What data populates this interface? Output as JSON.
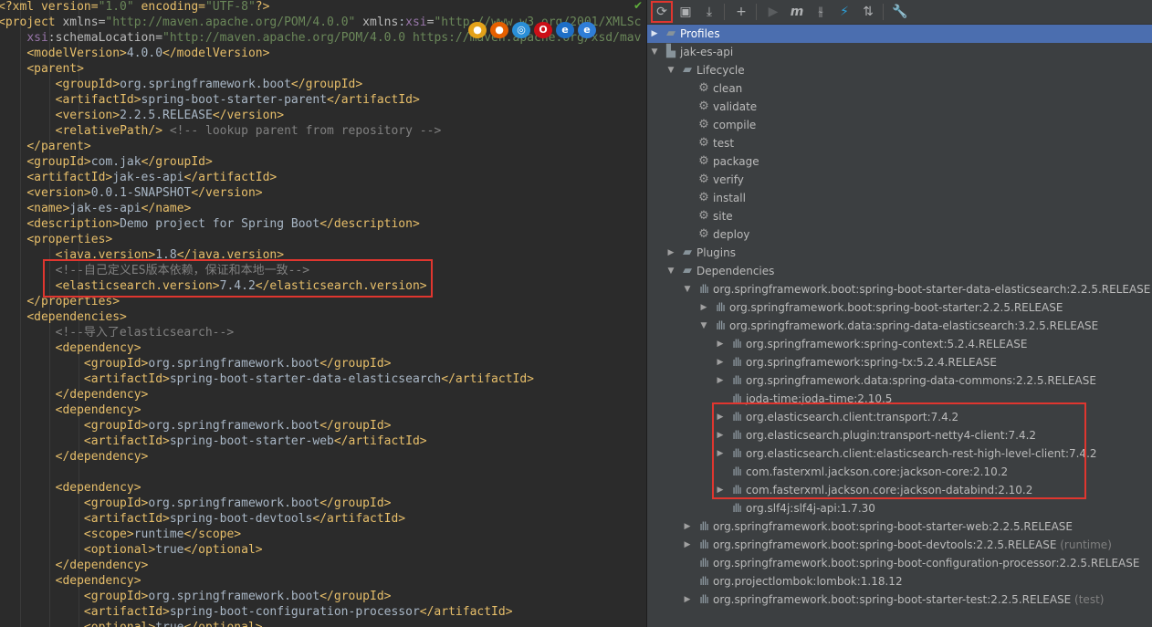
{
  "editor": {
    "lines": [
      [
        [
          "t",
          "<?xml version="
        ],
        [
          "v",
          "\"1.0\""
        ],
        [
          "t",
          " encoding="
        ],
        [
          "v",
          "\"UTF-8\""
        ],
        [
          "t",
          "?>"
        ]
      ],
      [
        [
          "t",
          "<project "
        ],
        [
          "a",
          "xmlns="
        ],
        [
          "v",
          "\"http://maven.apache.org/POM/4.0.0\""
        ],
        [
          "a",
          " xmlns"
        ],
        [
          "tx",
          ":"
        ],
        [
          "ns",
          "xsi"
        ],
        [
          "a",
          "="
        ],
        [
          "v",
          "\"http://www.w3.org/2001/XMLSc"
        ]
      ],
      [
        [
          "tx",
          "    "
        ],
        [
          "ns",
          "xsi"
        ],
        [
          "a",
          ":schemaLocation="
        ],
        [
          "v",
          "\"http://maven.apache.org/POM/4.0.0 https://maven.apache.org/xsd/mav"
        ]
      ],
      [
        [
          "tx",
          "    "
        ],
        [
          "t",
          "<modelVersion>"
        ],
        [
          "tx",
          "4.0.0"
        ],
        [
          "t",
          "</modelVersion>"
        ]
      ],
      [
        [
          "tx",
          "    "
        ],
        [
          "t",
          "<parent>"
        ]
      ],
      [
        [
          "tx",
          "        "
        ],
        [
          "t",
          "<groupId>"
        ],
        [
          "tx",
          "org.springframework.boot"
        ],
        [
          "t",
          "</groupId>"
        ]
      ],
      [
        [
          "tx",
          "        "
        ],
        [
          "t",
          "<artifactId>"
        ],
        [
          "tx",
          "spring-boot-starter-parent"
        ],
        [
          "t",
          "</artifactId>"
        ]
      ],
      [
        [
          "tx",
          "        "
        ],
        [
          "t",
          "<version>"
        ],
        [
          "tx",
          "2.2.5.RELEASE"
        ],
        [
          "t",
          "</version>"
        ]
      ],
      [
        [
          "tx",
          "        "
        ],
        [
          "t",
          "<relativePath/>"
        ],
        [
          "c",
          " <!-- lookup parent from repository -->"
        ]
      ],
      [
        [
          "tx",
          "    "
        ],
        [
          "t",
          "</parent>"
        ]
      ],
      [
        [
          "tx",
          "    "
        ],
        [
          "t",
          "<groupId>"
        ],
        [
          "tx",
          "com.jak"
        ],
        [
          "t",
          "</groupId>"
        ]
      ],
      [
        [
          "tx",
          "    "
        ],
        [
          "t",
          "<artifactId>"
        ],
        [
          "tx",
          "jak-es-api"
        ],
        [
          "t",
          "</artifactId>"
        ]
      ],
      [
        [
          "tx",
          "    "
        ],
        [
          "t",
          "<version>"
        ],
        [
          "tx",
          "0.0.1-SNAPSHOT"
        ],
        [
          "t",
          "</version>"
        ]
      ],
      [
        [
          "tx",
          "    "
        ],
        [
          "t",
          "<name>"
        ],
        [
          "tx",
          "jak-es-api"
        ],
        [
          "t",
          "</name>"
        ]
      ],
      [
        [
          "tx",
          "    "
        ],
        [
          "t",
          "<description>"
        ],
        [
          "tx",
          "Demo project for Spring Boot"
        ],
        [
          "t",
          "</description>"
        ]
      ],
      [
        [
          "tx",
          "    "
        ],
        [
          "t",
          "<properties>"
        ]
      ],
      [
        [
          "tx",
          "        "
        ],
        [
          "t",
          "<java.version>"
        ],
        [
          "tx",
          "1.8"
        ],
        [
          "t",
          "</java.version>"
        ]
      ],
      [
        [
          "tx",
          "        "
        ],
        [
          "c",
          "<!--自己定义ES版本依赖，保证和本地一致-->"
        ]
      ],
      [
        [
          "tx",
          "        "
        ],
        [
          "t",
          "<elasticsearch.version>"
        ],
        [
          "tx",
          "7.4.2"
        ],
        [
          "t",
          "</elasticsearch.version>"
        ]
      ],
      [
        [
          "tx",
          "    "
        ],
        [
          "t",
          "</properties>"
        ]
      ],
      [
        [
          "tx",
          "    "
        ],
        [
          "t",
          "<dependencies>"
        ]
      ],
      [
        [
          "tx",
          "        "
        ],
        [
          "c",
          "<!--导入了elasticsearch-->"
        ]
      ],
      [
        [
          "tx",
          "        "
        ],
        [
          "t",
          "<dependency>"
        ]
      ],
      [
        [
          "tx",
          "            "
        ],
        [
          "t",
          "<groupId>"
        ],
        [
          "tx",
          "org.springframework.boot"
        ],
        [
          "t",
          "</groupId>"
        ]
      ],
      [
        [
          "tx",
          "            "
        ],
        [
          "t",
          "<artifactId>"
        ],
        [
          "tx",
          "spring-boot-starter-data-elasticsearch"
        ],
        [
          "t",
          "</artifactId>"
        ]
      ],
      [
        [
          "tx",
          "        "
        ],
        [
          "t",
          "</dependency>"
        ]
      ],
      [
        [
          "tx",
          "        "
        ],
        [
          "t",
          "<dependency>"
        ]
      ],
      [
        [
          "tx",
          "            "
        ],
        [
          "t",
          "<groupId>"
        ],
        [
          "tx",
          "org.springframework.boot"
        ],
        [
          "t",
          "</groupId>"
        ]
      ],
      [
        [
          "tx",
          "            "
        ],
        [
          "t",
          "<artifactId>"
        ],
        [
          "tx",
          "spring-boot-starter-web"
        ],
        [
          "t",
          "</artifactId>"
        ]
      ],
      [
        [
          "tx",
          "        "
        ],
        [
          "t",
          "</dependency>"
        ]
      ],
      [],
      [
        [
          "tx",
          "        "
        ],
        [
          "t",
          "<dependency>"
        ]
      ],
      [
        [
          "tx",
          "            "
        ],
        [
          "t",
          "<groupId>"
        ],
        [
          "tx",
          "org.springframework.boot"
        ],
        [
          "t",
          "</groupId>"
        ]
      ],
      [
        [
          "tx",
          "            "
        ],
        [
          "t",
          "<artifactId>"
        ],
        [
          "tx",
          "spring-boot-devtools"
        ],
        [
          "t",
          "</artifactId>"
        ]
      ],
      [
        [
          "tx",
          "            "
        ],
        [
          "t",
          "<scope>"
        ],
        [
          "tx",
          "runtime"
        ],
        [
          "t",
          "</scope>"
        ]
      ],
      [
        [
          "tx",
          "            "
        ],
        [
          "t",
          "<optional>"
        ],
        [
          "tx",
          "true"
        ],
        [
          "t",
          "</optional>"
        ]
      ],
      [
        [
          "tx",
          "        "
        ],
        [
          "t",
          "</dependency>"
        ]
      ],
      [
        [
          "tx",
          "        "
        ],
        [
          "t",
          "<dependency>"
        ]
      ],
      [
        [
          "tx",
          "            "
        ],
        [
          "t",
          "<groupId>"
        ],
        [
          "tx",
          "org.springframework.boot"
        ],
        [
          "t",
          "</groupId>"
        ]
      ],
      [
        [
          "tx",
          "            "
        ],
        [
          "t",
          "<artifactId>"
        ],
        [
          "tx",
          "spring-boot-configuration-processor"
        ],
        [
          "t",
          "</artifactId>"
        ]
      ],
      [
        [
          "tx",
          "            "
        ],
        [
          "t",
          "<optional>"
        ],
        [
          "tx",
          "true"
        ],
        [
          "t",
          "</optional>"
        ]
      ]
    ],
    "browser_icons": [
      {
        "name": "chrome-icon",
        "color": "#e3a21a"
      },
      {
        "name": "firefox-icon",
        "color": "#e66000"
      },
      {
        "name": "safari-icon",
        "color": "#2a8fd6"
      },
      {
        "name": "opera-icon",
        "color": "#cc0f16"
      },
      {
        "name": "ie-icon",
        "color": "#1e6fc7"
      },
      {
        "name": "edge-icon",
        "color": "#2f7ed8"
      }
    ]
  },
  "toolbar": {
    "buttons": [
      {
        "name": "reimport-button",
        "icon": "⟳"
      },
      {
        "name": "generate-sources-button",
        "icon": "▣"
      },
      {
        "name": "download-sources-button",
        "icon": "⤓"
      },
      {
        "name": "add-maven-project-button",
        "icon": "+"
      },
      {
        "name": "run-maven-build-button",
        "icon": "▶"
      },
      {
        "name": "execute-goal-button",
        "icon": "m"
      },
      {
        "name": "toggle-offline-button",
        "icon": "⫳"
      },
      {
        "name": "skip-tests-button",
        "icon": "⚡"
      },
      {
        "name": "show-dependencies-button",
        "icon": "⇅"
      },
      {
        "name": "maven-settings-button",
        "icon": "🔧"
      }
    ]
  },
  "tree": [
    {
      "depth": 0,
      "arrow": "right",
      "icon": "folder",
      "label": "Profiles",
      "selected": true
    },
    {
      "depth": 0,
      "arrow": "down",
      "icon": "project",
      "label": "jak-es-api"
    },
    {
      "depth": 1,
      "arrow": "down",
      "icon": "folder",
      "label": "Lifecycle"
    },
    {
      "depth": 2,
      "arrow": "",
      "icon": "gear",
      "label": "clean"
    },
    {
      "depth": 2,
      "arrow": "",
      "icon": "gear",
      "label": "validate"
    },
    {
      "depth": 2,
      "arrow": "",
      "icon": "gear",
      "label": "compile"
    },
    {
      "depth": 2,
      "arrow": "",
      "icon": "gear",
      "label": "test"
    },
    {
      "depth": 2,
      "arrow": "",
      "icon": "gear",
      "label": "package"
    },
    {
      "depth": 2,
      "arrow": "",
      "icon": "gear",
      "label": "verify"
    },
    {
      "depth": 2,
      "arrow": "",
      "icon": "gear",
      "label": "install"
    },
    {
      "depth": 2,
      "arrow": "",
      "icon": "gear",
      "label": "site"
    },
    {
      "depth": 2,
      "arrow": "",
      "icon": "gear",
      "label": "deploy"
    },
    {
      "depth": 1,
      "arrow": "right",
      "icon": "folder",
      "label": "Plugins"
    },
    {
      "depth": 1,
      "arrow": "down",
      "icon": "folder",
      "label": "Dependencies"
    },
    {
      "depth": 2,
      "arrow": "down",
      "icon": "dep",
      "label": "org.springframework.boot:spring-boot-starter-data-elasticsearch:2.2.5.RELEASE"
    },
    {
      "depth": 3,
      "arrow": "right",
      "icon": "dep",
      "label": "org.springframework.boot:spring-boot-starter:2.2.5.RELEASE"
    },
    {
      "depth": 3,
      "arrow": "down",
      "icon": "dep",
      "label": "org.springframework.data:spring-data-elasticsearch:3.2.5.RELEASE"
    },
    {
      "depth": 4,
      "arrow": "right",
      "icon": "dep",
      "label": "org.springframework:spring-context:5.2.4.RELEASE"
    },
    {
      "depth": 4,
      "arrow": "right",
      "icon": "dep",
      "label": "org.springframework:spring-tx:5.2.4.RELEASE"
    },
    {
      "depth": 4,
      "arrow": "right",
      "icon": "dep",
      "label": "org.springframework.data:spring-data-commons:2.2.5.RELEASE"
    },
    {
      "depth": 4,
      "arrow": "",
      "icon": "dep",
      "label": "joda-time:joda-time:2.10.5"
    },
    {
      "depth": 4,
      "arrow": "right",
      "icon": "dep",
      "label": "org.elasticsearch.client:transport:7.4.2"
    },
    {
      "depth": 4,
      "arrow": "right",
      "icon": "dep",
      "label": "org.elasticsearch.plugin:transport-netty4-client:7.4.2"
    },
    {
      "depth": 4,
      "arrow": "right",
      "icon": "dep",
      "label": "org.elasticsearch.client:elasticsearch-rest-high-level-client:7.4.2"
    },
    {
      "depth": 4,
      "arrow": "",
      "icon": "dep",
      "label": "com.fasterxml.jackson.core:jackson-core:2.10.2"
    },
    {
      "depth": 4,
      "arrow": "right",
      "icon": "dep",
      "label": "com.fasterxml.jackson.core:jackson-databind:2.10.2"
    },
    {
      "depth": 4,
      "arrow": "",
      "icon": "dep",
      "label": "org.slf4j:slf4j-api:1.7.30"
    },
    {
      "depth": 2,
      "arrow": "right",
      "icon": "dep",
      "label": "org.springframework.boot:spring-boot-starter-web:2.2.5.RELEASE"
    },
    {
      "depth": 2,
      "arrow": "right",
      "icon": "dep",
      "label": "org.springframework.boot:spring-boot-devtools:2.2.5.RELEASE",
      "suffix": "(runtime)"
    },
    {
      "depth": 2,
      "arrow": "",
      "icon": "dep",
      "label": "org.springframework.boot:spring-boot-configuration-processor:2.2.5.RELEASE"
    },
    {
      "depth": 2,
      "arrow": "",
      "icon": "dep",
      "label": "org.projectlombok:lombok:1.18.12"
    },
    {
      "depth": 2,
      "arrow": "right",
      "icon": "dep",
      "label": "org.springframework.boot:spring-boot-starter-test:2.2.5.RELEASE",
      "suffix": "(test)"
    }
  ],
  "colors": {
    "editor_bg": "#2b2b2b",
    "panel_bg": "#3c3f41",
    "selection": "#4b6eaf",
    "highlight_box": "#e0362f",
    "xml_tag": "#e8bf6a",
    "xml_string": "#6a8759",
    "xml_comment": "#808080"
  }
}
